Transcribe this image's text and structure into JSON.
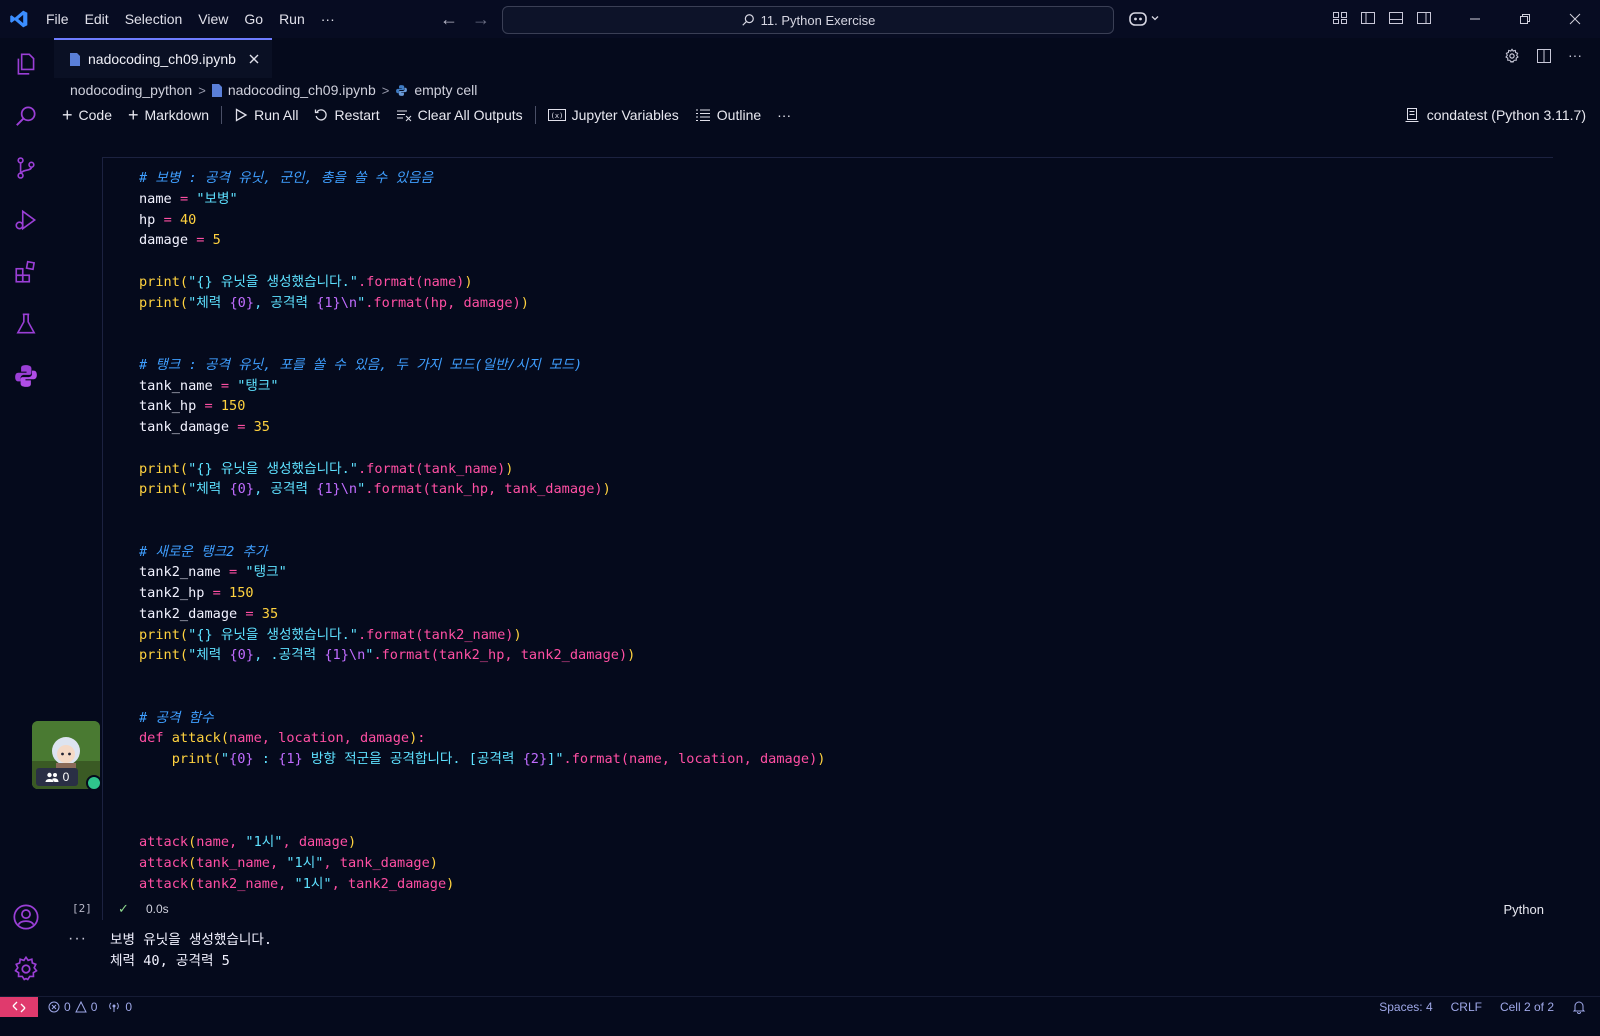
{
  "titlebar": {
    "menu": [
      "File",
      "Edit",
      "Selection",
      "View",
      "Go",
      "Run",
      "···"
    ],
    "search_text": "11. Python Exercise"
  },
  "tab": {
    "label": "nadocoding_ch09.ipynb"
  },
  "breadcrumb": [
    "nodocoding_python",
    "nadocoding_ch09.ipynb",
    "empty cell"
  ],
  "toolbar": {
    "code": "Code",
    "markdown": "Markdown",
    "run_all": "Run All",
    "restart": "Restart",
    "clear_outputs": "Clear All Outputs",
    "variables": "Jupyter Variables",
    "outline": "Outline",
    "more": "···",
    "kernel": "condatest (Python 3.11.7)"
  },
  "cell": {
    "execution_count": "[2]",
    "exec_time": "0.0s",
    "language": "Python"
  },
  "code": {
    "c1": "# 보병 : 공격 유닛, 군인, 총을 쏠 수 있음음",
    "name_str": "\"보병\"",
    "hp_val": "40",
    "damage_val": "5",
    "p1_str": "\"{} 유닛을 생성했습니다.\"",
    "p2_str1": "\"체력 ",
    "p2_str2": ", 공격력 ",
    "c2": "# 탱크 : 공격 유닛, 포를 쏠 수 있음, 두 가지 모드(일반/시지 모드)",
    "tank_name_str": "\"탱크\"",
    "tank_hp_val": "150",
    "tank_damage_val": "35",
    "c3": "# 새로운 탱크2 추가",
    "tank2_name_str": "\"탱크\"",
    "tank2_hp_val": "150",
    "tank2_damage_val": "35",
    "p6_str2": ", .공격력 ",
    "c4": "# 공격 함수",
    "attack_str1": "\"",
    "attack_str2": " : ",
    "attack_str3": " 방향 적군을 공격합니다. [공격력 ",
    "attack_str4": "]\"",
    "loc_str": "\"1시\""
  },
  "output": {
    "line1": "보병 유닛을 생성했습니다.",
    "line2": "체력 40, 공격력 5"
  },
  "avatar": {
    "count": "0"
  },
  "statusbar": {
    "errors": "0",
    "warnings": "0",
    "ports": "0",
    "spaces": "Spaces: 4",
    "eol": "CRLF",
    "cell_pos": "Cell 2 of 2"
  },
  "colors": {
    "accent": "#6e7cff",
    "background": "#050a1c",
    "remote": "#e03a6d"
  }
}
